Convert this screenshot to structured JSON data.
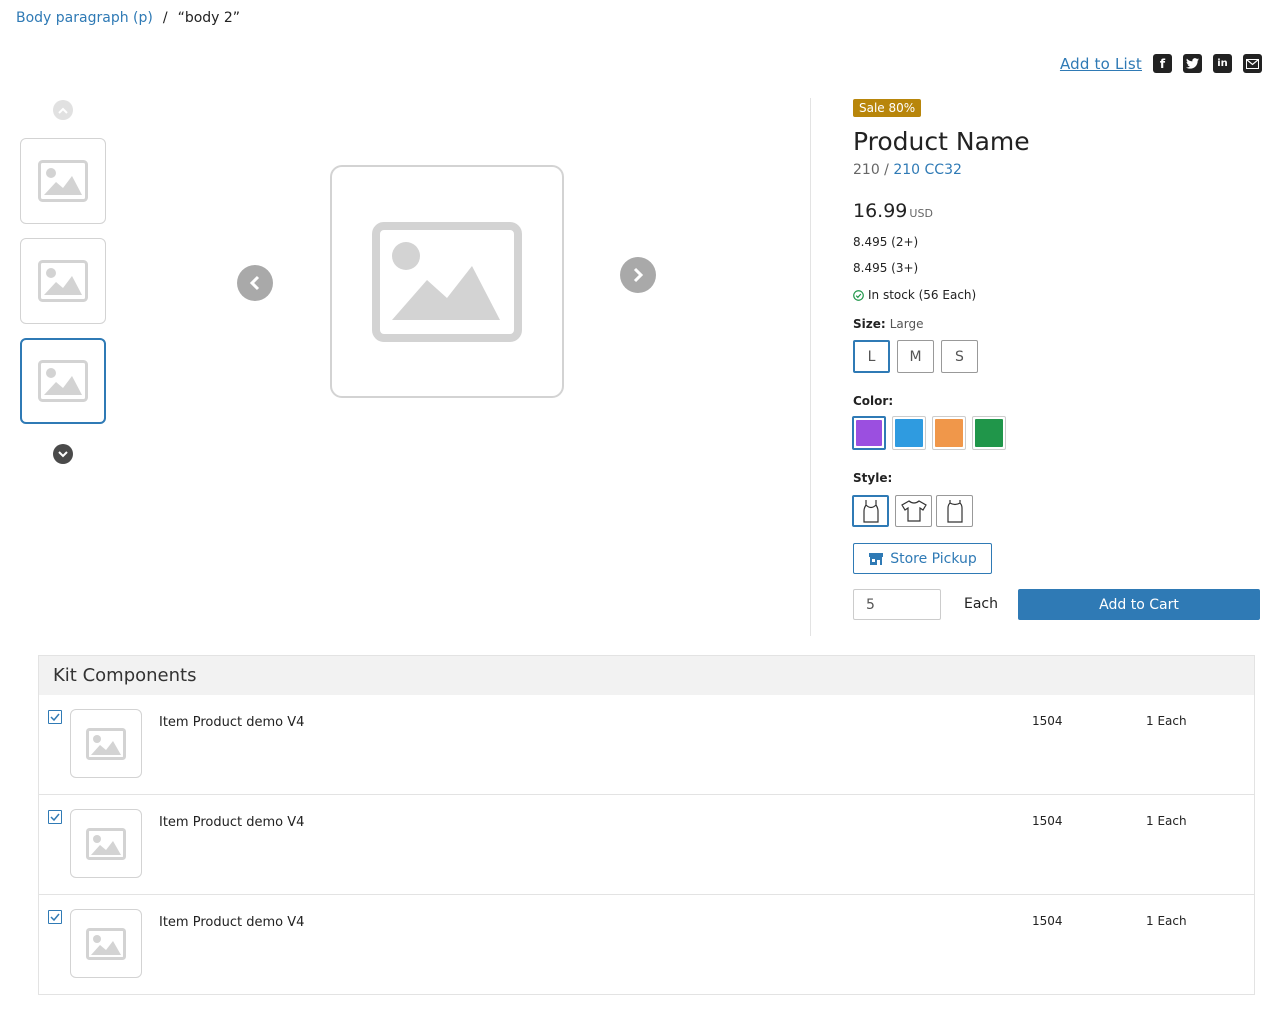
{
  "breadcrumb": {
    "link": "Body paragraph (p)",
    "separator": "/",
    "current": "“body 2”"
  },
  "share": {
    "add_to_list": "Add to List",
    "icons": [
      "facebook-icon",
      "twitter-icon",
      "linkedin-icon",
      "email-icon"
    ],
    "facebook_glyph": "f",
    "linkedin_glyph": "in"
  },
  "gallery": {
    "thumbnails": 3,
    "active_thumbnail": 3
  },
  "product": {
    "badge": "Sale 80%",
    "name": "Product Name",
    "sku_prefix": "210 /",
    "sku_link": "210 CC32",
    "price": "16.99",
    "currency": "USD",
    "tiers": [
      "8.495 (2+)",
      "8.495 (3+)"
    ],
    "stock": "In stock (56 Each)",
    "size_label": "Size:",
    "size_value": "Large",
    "sizes": [
      "L",
      "M",
      "S"
    ],
    "selected_size": "L",
    "color_label": "Color:",
    "colors": [
      "#9b4fe0",
      "#2f9be0",
      "#f0974a",
      "#20964a"
    ],
    "selected_color": 0,
    "style_label": "Style:",
    "styles": [
      "tank-top-icon",
      "t-shirt-icon",
      "sleeveless-icon"
    ],
    "selected_style": 0,
    "store_pickup": "Store Pickup",
    "quantity": "5",
    "uom": "Each",
    "add_to_cart": "Add to Cart"
  },
  "accent_color": "#2f7ab5",
  "badge_color": "#b8860b",
  "kit": {
    "title": "Kit Components",
    "rows": [
      {
        "name": "Item Product demo V4",
        "number": "1504",
        "qty": "1 Each",
        "checked": true
      },
      {
        "name": "Item Product demo V4",
        "number": "1504",
        "qty": "1 Each",
        "checked": true
      },
      {
        "name": "Item Product demo V4",
        "number": "1504",
        "qty": "1 Each",
        "checked": true
      }
    ]
  }
}
